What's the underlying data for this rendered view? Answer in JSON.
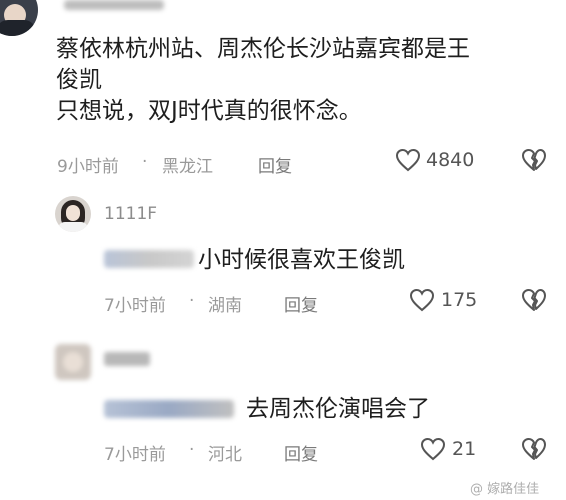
{
  "comments": [
    {
      "username": "",
      "content_lines": [
        "蔡依林杭州站、周杰伦长沙站嘉宾都是王",
        "俊凯",
        "只想说，双J时代真的很怀念。"
      ],
      "time": "9小时前",
      "location": "黑龙江",
      "reply_label": "回复",
      "likes": "4840",
      "like_icon": "heart-outline-icon",
      "dislike_icon": "broken-heart-icon"
    },
    {
      "username": "1111F",
      "mention": "",
      "content": "小时候很喜欢王俊凯",
      "time": "7小时前",
      "location": "湖南",
      "reply_label": "回复",
      "likes": "175",
      "like_icon": "heart-outline-icon",
      "dislike_icon": "broken-heart-icon"
    },
    {
      "username": "",
      "mention": "",
      "content": "去周杰伦演唱会了",
      "time": "7小时前",
      "location": "河北",
      "reply_label": "回复",
      "likes": "21",
      "like_icon": "heart-outline-icon",
      "dislike_icon": "broken-heart-icon"
    }
  ],
  "watermark": "@ 嫁路佳佳",
  "colors": {
    "meta_text": "#9a9a9a",
    "content_text": "#1e1e1e",
    "icon": "#555555"
  }
}
